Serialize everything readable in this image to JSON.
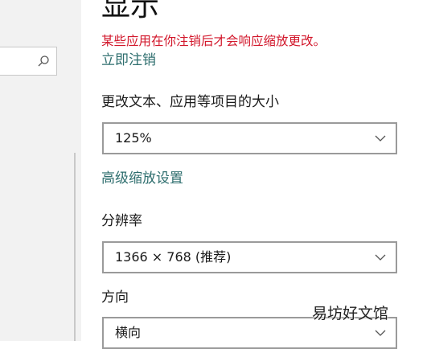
{
  "sidebar": {
    "search": {
      "placeholder": "",
      "icon": "search-icon"
    }
  },
  "main": {
    "title": "显示",
    "warning": "某些应用在你注销后才会响应缩放更改。",
    "sign_out_link": "立即注销",
    "scale_label": "更改文本、应用等项目的大小",
    "scale_value": "125%",
    "advanced_scaling_link": "高级缩放设置",
    "resolution_label": "分辨率",
    "resolution_value": "1366 × 768 (推荐)",
    "orientation_label": "方向",
    "orientation_value": "横向"
  },
  "watermark": "易坊好文馆",
  "colors": {
    "warning": "#d2172b",
    "link": "#2e6e6e",
    "dropdown_border": "#9a9a9a",
    "sidebar_bg": "#f2f2f2"
  }
}
